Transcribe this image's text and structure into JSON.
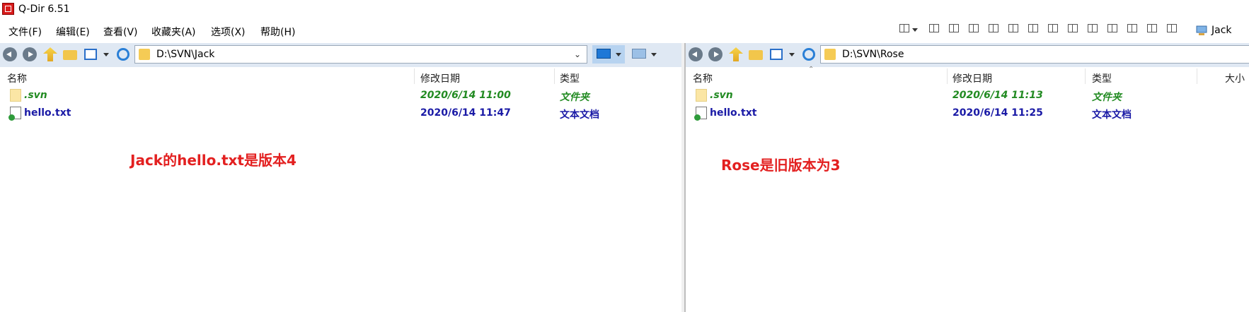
{
  "window": {
    "title": "Q-Dir 6.51"
  },
  "menu": [
    "文件(F)",
    "编辑(E)",
    "查看(V)",
    "收藏夹(A)",
    "选项(X)",
    "帮助(H)"
  ],
  "toolbar": {
    "user_label": "Jack"
  },
  "columns": {
    "name": "名称",
    "modified": "修改日期",
    "type": "类型",
    "size": "大小"
  },
  "left_pane": {
    "path": "D:\\SVN\\Jack",
    "files": [
      {
        "name": ".svn",
        "modified": "2020/6/14 11:00",
        "type": "文件夹"
      },
      {
        "name": "hello.txt",
        "modified": "2020/6/14 11:47",
        "type": "文本文档"
      }
    ],
    "annotation": "Jack的hello.txt是版本4"
  },
  "right_pane": {
    "path": "D:\\SVN\\Rose",
    "files": [
      {
        "name": ".svn",
        "modified": "2020/6/14 11:13",
        "type": "文件夹"
      },
      {
        "name": "hello.txt",
        "modified": "2020/6/14 11:25",
        "type": "文本文档"
      }
    ],
    "annotation": "Rose是旧版本为3"
  },
  "colors": {
    "accent": "#dfe8f3",
    "svn_green": "#228b22",
    "file_blue": "#1a1aa6",
    "annotation_red": "#e32020"
  }
}
